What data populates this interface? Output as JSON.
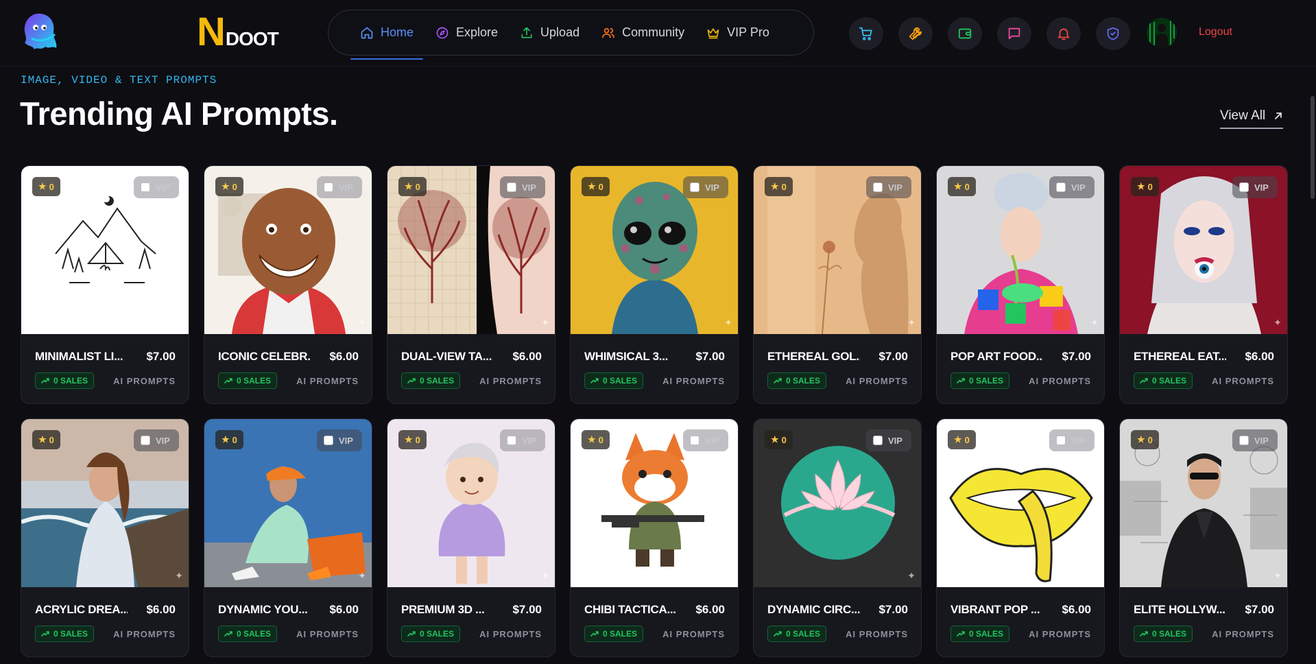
{
  "brand": {
    "initial": "N",
    "rest": "DOOT"
  },
  "nav": [
    {
      "label": "Home",
      "icon": "home-icon",
      "active": true
    },
    {
      "label": "Explore",
      "icon": "compass-icon"
    },
    {
      "label": "Upload",
      "icon": "upload-icon"
    },
    {
      "label": "Community",
      "icon": "users-icon"
    },
    {
      "label": "VIP Pro",
      "icon": "crown-icon"
    }
  ],
  "header_actions": {
    "icons": [
      "cart-icon",
      "wrench-icon",
      "wallet-icon",
      "chat-icon",
      "bell-icon",
      "shield-icon"
    ],
    "logout": "Logout"
  },
  "section": {
    "eyebrow": "IMAGE, VIDEO & TEXT PROMPTS",
    "title": "Trending AI Prompts.",
    "view_all": "View All"
  },
  "card_labels": {
    "vip": "VIP",
    "sales_suffix": " SALES",
    "category": "AI PROMPTS"
  },
  "products": [
    {
      "title": "MINIMALIST LI...",
      "price": "$7.00",
      "rating": "0",
      "sales": "0",
      "image": "mountain-camp-line-art"
    },
    {
      "title": "ICONIC CELEBR...",
      "price": "$6.00",
      "rating": "0",
      "sales": "0",
      "image": "basketball-caricature"
    },
    {
      "title": "DUAL-VIEW TA...",
      "price": "$6.00",
      "rating": "0",
      "sales": "0",
      "image": "tree-tattoo"
    },
    {
      "title": "WHIMSICAL 3...",
      "price": "$7.00",
      "rating": "0",
      "sales": "0",
      "image": "alien-mosaic"
    },
    {
      "title": "ETHEREAL GOL...",
      "price": "$7.00",
      "rating": "0",
      "sales": "0",
      "image": "woman-silhouette-rose"
    },
    {
      "title": "POP ART FOOD...",
      "price": "$7.00",
      "rating": "0",
      "sales": "0",
      "image": "pop-art-woman-noodles"
    },
    {
      "title": "ETHEREAL EAT...",
      "price": "$6.00",
      "rating": "0",
      "sales": "0",
      "image": "white-hair-woman-eye"
    },
    {
      "title": "ACRYLIC DREA...",
      "price": "$6.00",
      "rating": "0",
      "sales": "0",
      "image": "woman-by-sea-painting"
    },
    {
      "title": "DYNAMIC YOU...",
      "price": "$6.00",
      "rating": "0",
      "sales": "0",
      "image": "woman-orange-cap"
    },
    {
      "title": "PREMIUM 3D ...",
      "price": "$7.00",
      "rating": "0",
      "sales": "0",
      "image": "3d-grandma-hoodie"
    },
    {
      "title": "CHIBI TACTICA...",
      "price": "$6.00",
      "rating": "0",
      "sales": "0",
      "image": "chibi-fox-soldier"
    },
    {
      "title": "DYNAMIC CIRC...",
      "price": "$7.00",
      "rating": "0",
      "sales": "0",
      "image": "lotus-circle-logo"
    },
    {
      "title": "VIBRANT POP ...",
      "price": "$6.00",
      "rating": "0",
      "sales": "0",
      "image": "lips-banana"
    },
    {
      "title": "ELITE HOLLYW...",
      "price": "$7.00",
      "rating": "0",
      "sales": "0",
      "image": "man-in-suit"
    }
  ],
  "colors": {
    "accent": "#3b6fe0",
    "brand": "#f5b90a",
    "sales": "#22c55e",
    "logout": "#ef4444",
    "eyebrow": "#35b8f0"
  }
}
